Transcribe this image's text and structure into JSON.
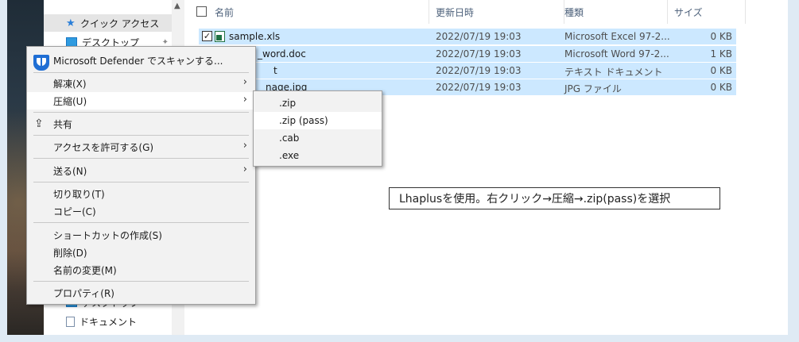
{
  "nav": {
    "quick_access": "クイック アクセス",
    "desktop": "デスクトップ",
    "partial_desktop": "デスクトップ",
    "documents": "ドキュメント"
  },
  "columns": {
    "name": "名前",
    "modified": "更新日時",
    "type": "種類",
    "size": "サイズ"
  },
  "files": [
    {
      "name": "sample.xls",
      "modified": "2022/07/19 19:03",
      "type": "Microsoft Excel 97-2...",
      "size": "0 KB"
    },
    {
      "name": "_word.doc",
      "modified": "2022/07/19 19:03",
      "type": "Microsoft Word 97-2...",
      "size": "1 KB"
    },
    {
      "name": "t",
      "modified": "2022/07/19 19:03",
      "type": "テキスト ドキュメント",
      "size": "0 KB"
    },
    {
      "name": "nage.jpg",
      "modified": "2022/07/19 19:03",
      "type": "JPG ファイル",
      "size": "0 KB"
    }
  ],
  "context_menu": {
    "defender": "Microsoft Defender でスキャンする...",
    "extract": "解凍(X)",
    "compress": "圧縮(U)",
    "share": "共有",
    "grant_access": "アクセスを許可する(G)",
    "send_to": "送る(N)",
    "cut": "切り取り(T)",
    "copy": "コピー(C)",
    "create_shortcut": "ショートカットの作成(S)",
    "delete": "削除(D)",
    "rename": "名前の変更(M)",
    "properties": "プロパティ(R)"
  },
  "compress_submenu": {
    "zip": ".zip",
    "zip_pass": ".zip (pass)",
    "cab": ".cab",
    "exe": ".exe"
  },
  "annotation": "Lhaplusを使用。右クリック→圧縮→.zip(pass)を選択",
  "colors": {
    "selection": "#cce8ff",
    "menu_bg": "#f2f2f2",
    "menu_highlight": "#ffffff",
    "frame_bg": "#dfeaf4"
  }
}
